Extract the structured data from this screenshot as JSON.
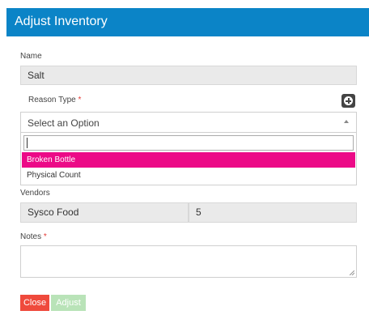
{
  "header": {
    "title": "Adjust Inventory"
  },
  "name_field": {
    "label": "Name",
    "value": "Salt"
  },
  "reason": {
    "label": "Reason Type",
    "required_mark": "*",
    "selected": "Select an Option",
    "search_value": "",
    "options": [
      {
        "label": "Broken Bottle",
        "highlighted": true
      },
      {
        "label": "Physical Count",
        "highlighted": false
      }
    ]
  },
  "vendors": {
    "label": "Vendors",
    "vendor": "Sysco Food",
    "quantity": "5"
  },
  "notes": {
    "label": "Notes",
    "required_mark": "*",
    "value": ""
  },
  "buttons": {
    "close_label": "Close",
    "adjust_label": "Adjust"
  },
  "colors": {
    "header_bg": "#0b84c7",
    "highlight_bg": "#ec0a87",
    "close_bg": "#ef4a3c",
    "adjust_bg": "#b9e3b8",
    "required": "#e53935"
  },
  "icons": {
    "add": "plus-circle-icon",
    "caret": "caret-up-icon"
  }
}
